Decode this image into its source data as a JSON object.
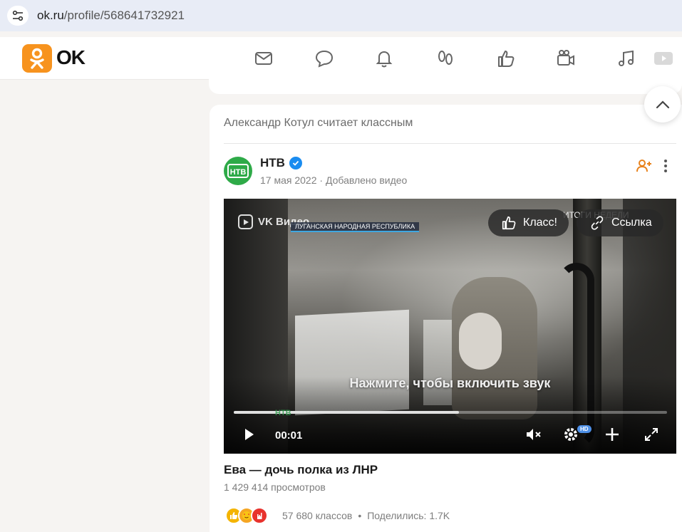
{
  "browser": {
    "url_host": "ok.ru",
    "url_path": "/profile/568641732921"
  },
  "header": {
    "logo_text": "OK",
    "nav_icons": [
      "messages-icon",
      "discussions-icon",
      "notifications-icon",
      "guests-icon",
      "likes-icon",
      "video-icon",
      "music-icon",
      "vk-video-icon"
    ]
  },
  "post": {
    "context_line": "Александр Котул считает классным",
    "author_name": "НТВ",
    "date": "17 мая 2022",
    "separator": "·",
    "action": "Добавлено видео",
    "video": {
      "brand": "VK Видео",
      "caption_tag": "ЛУГАНСКАЯ НАРОДНАЯ РЕСПУБЛИКА",
      "topright_text": "ИТОГИ НЕДЕЛИ",
      "class_button": "Класс!",
      "link_button": "Ссылка",
      "unmute_hint": "Нажмите, чтобы включить звук",
      "time": "00:01",
      "hd_label": "HD",
      "watermark": "НТВ",
      "progress": 0.52
    },
    "title": "Ева — дочь полка из ЛНР",
    "views": "1 429 414 просмотров",
    "classes_count": "57 680 классов",
    "bullet": "•",
    "shares": "Поделились: 1.7K"
  },
  "colors": {
    "ok_orange": "#f7931e",
    "ntv_green": "#2eaa48",
    "verified_blue": "#1a8cf0"
  }
}
